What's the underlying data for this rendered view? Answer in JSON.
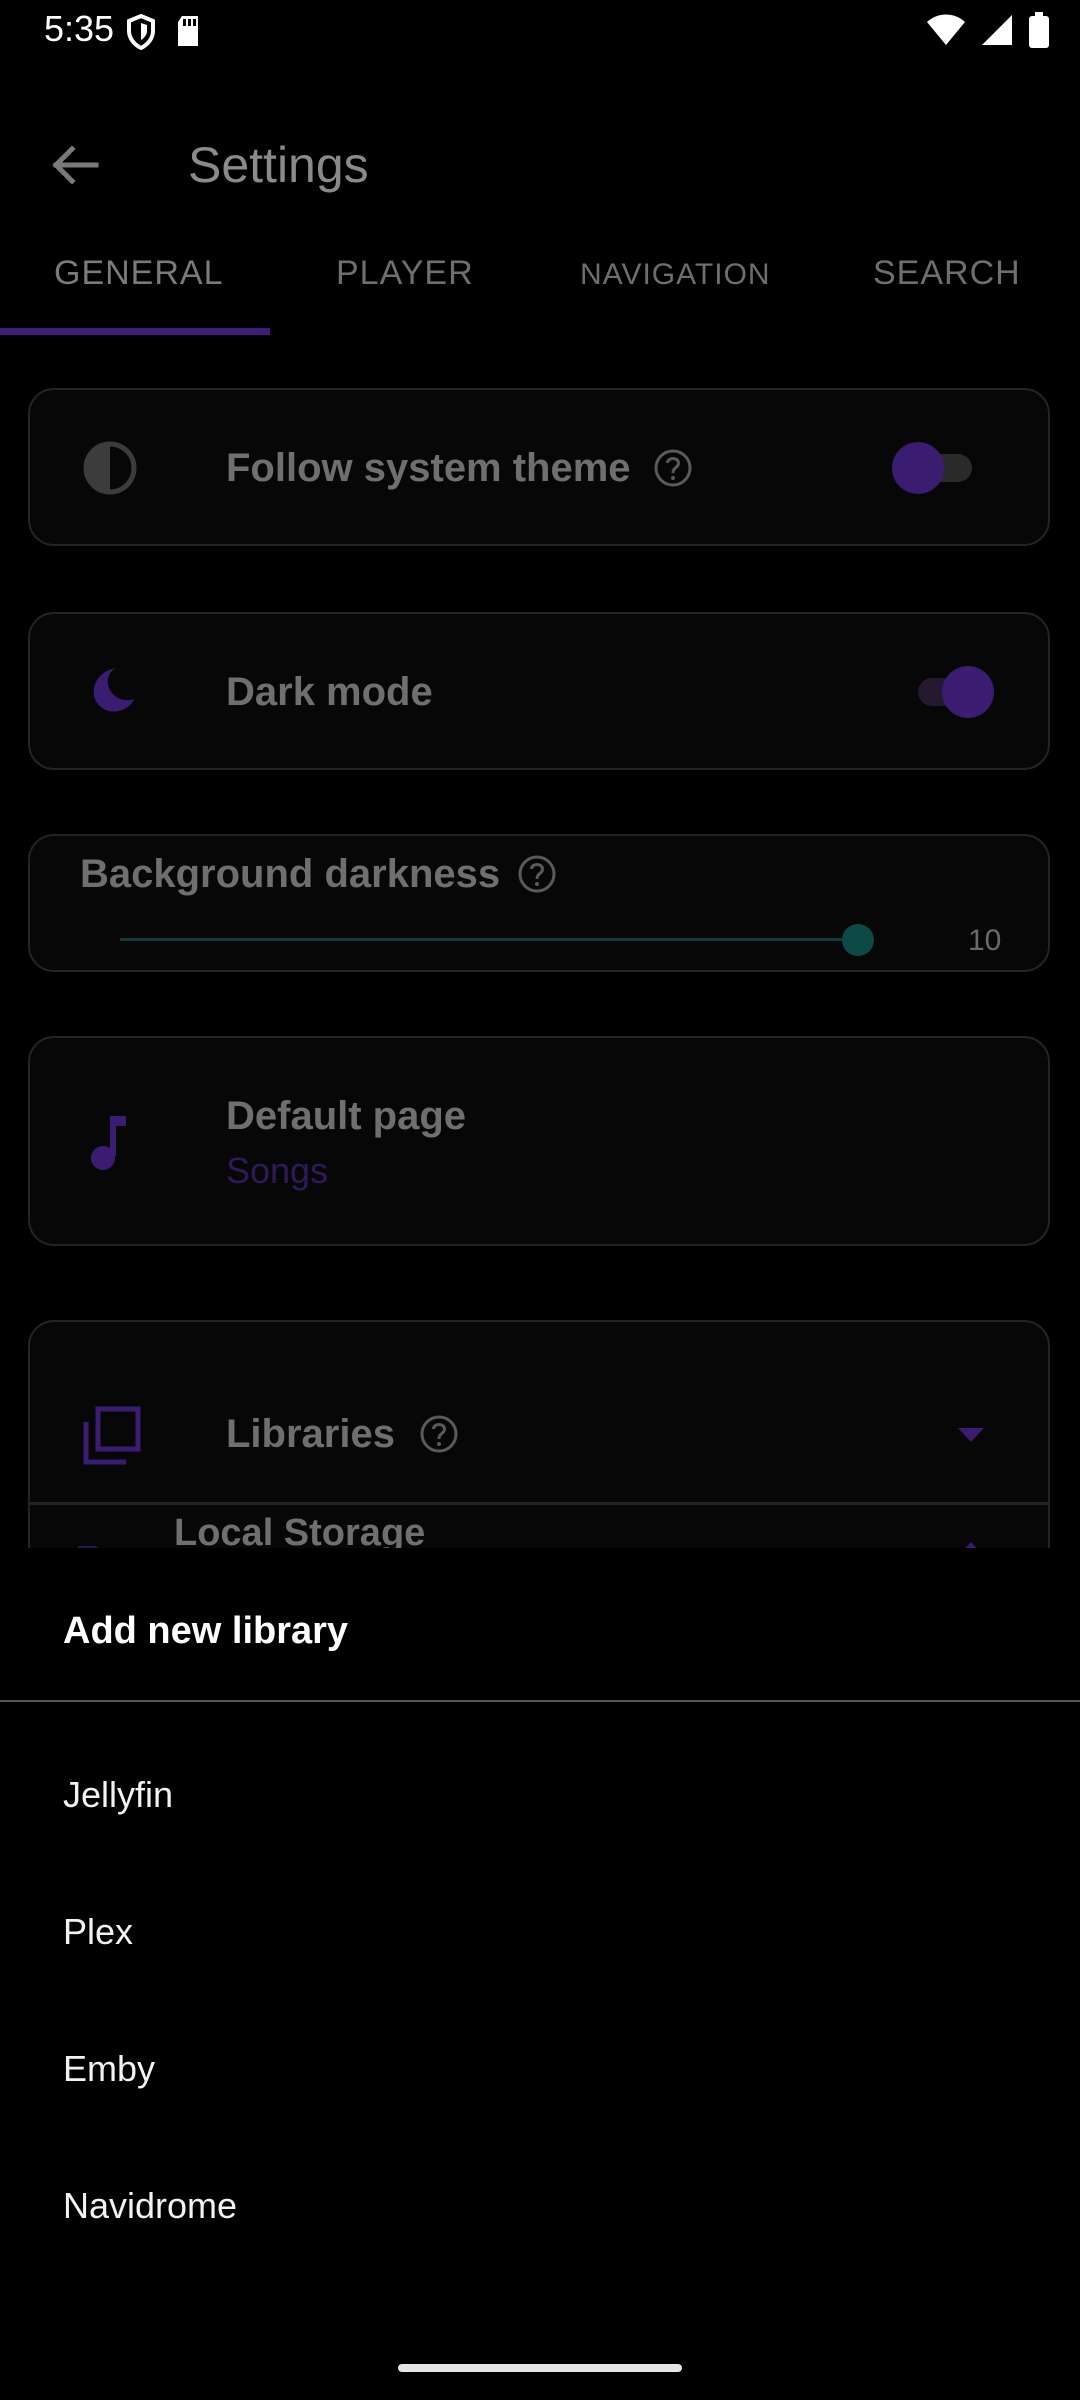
{
  "status_bar": {
    "time": "5:35"
  },
  "app_bar": {
    "title": "Settings"
  },
  "tabs": [
    {
      "label": "GENERAL",
      "active": true
    },
    {
      "label": "PLAYER"
    },
    {
      "label": "NAVIGATION"
    },
    {
      "label": "SEARCH"
    }
  ],
  "settings": {
    "follow_system_theme": {
      "label": "Follow system theme",
      "on": true
    },
    "dark_mode": {
      "label": "Dark mode",
      "on": true
    },
    "background_darkness": {
      "label": "Background darkness",
      "value": "10"
    },
    "default_page": {
      "label": "Default page",
      "value": "Songs"
    },
    "libraries": {
      "label": "Libraries",
      "sub_item": "Local Storage"
    }
  },
  "sheet": {
    "title": "Add new library",
    "items": [
      "Jellyfin",
      "Plex",
      "Emby",
      "Navidrome"
    ]
  },
  "colors": {
    "accent": "#3a1c70",
    "slider": "#0d4a45",
    "background": "#000000"
  }
}
